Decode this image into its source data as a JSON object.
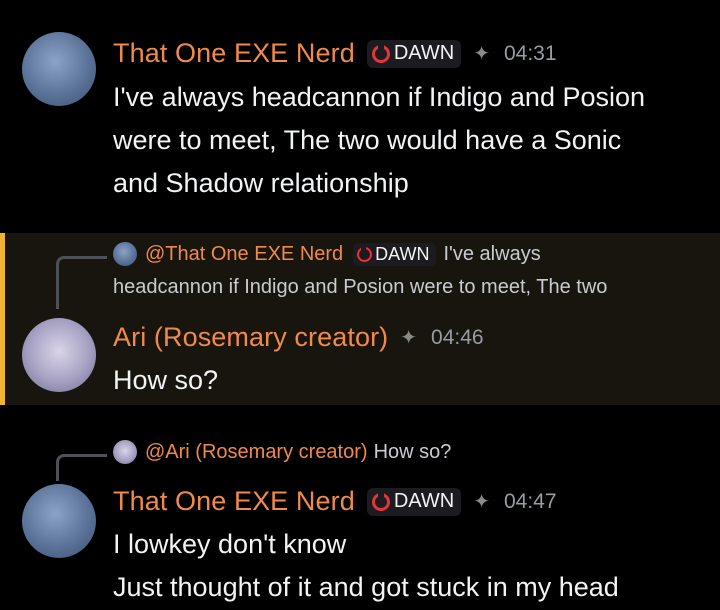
{
  "messages": [
    {
      "author": "That One EXE Nerd",
      "badge": "DAWN",
      "time": "04:31",
      "lines": [
        "I've always headcannon if Indigo and Posion",
        "were to meet, The two would have a Sonic",
        "and Shadow relationship"
      ]
    },
    {
      "reply": {
        "author": "@That One EXE Nerd",
        "badge": "DAWN",
        "text": "I've always",
        "text_cont": "headcannon if Indigo and Posion were to meet, The two"
      },
      "author": "Ari (Rosemary creator)",
      "time": "04:46",
      "lines": [
        "How so?"
      ]
    },
    {
      "reply": {
        "author": "@Ari (Rosemary creator)",
        "text": "How so?"
      },
      "author": "That One EXE Nerd",
      "badge": "DAWN",
      "time": "04:47",
      "lines": [
        "I lowkey don't know",
        "Just thought of it and got stuck in my head"
      ]
    }
  ],
  "colors": {
    "background": "#000000",
    "username": "#f08a4b",
    "highlight": "#17150e",
    "highlight_bar": "#f0b232",
    "badge_icon": "#e8323c"
  },
  "icons": {
    "badge": "dawn-badge-icon",
    "decoration": "decoration-icon"
  }
}
